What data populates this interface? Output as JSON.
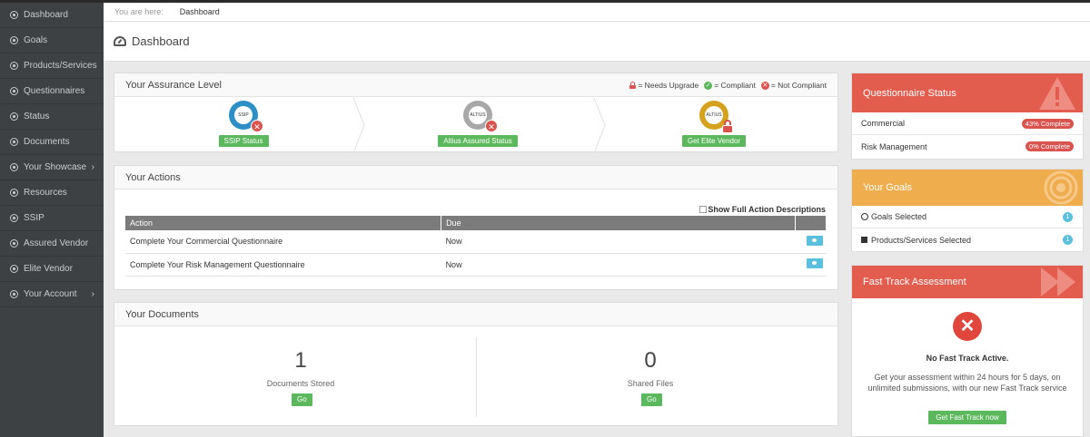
{
  "sidebar": {
    "items": [
      {
        "label": "Dashboard",
        "icon": "circle-dot-icon"
      },
      {
        "label": "Goals",
        "icon": "circle-dot-icon"
      },
      {
        "label": "Products/Services",
        "icon": "circle-dot-icon"
      },
      {
        "label": "Questionnaires",
        "icon": "circle-dot-icon"
      },
      {
        "label": "Status",
        "icon": "circle-dot-icon"
      },
      {
        "label": "Documents",
        "icon": "circle-dot-icon"
      },
      {
        "label": "Your Showcase",
        "icon": "circle-dot-icon",
        "chevron": "›"
      },
      {
        "label": "Resources",
        "icon": "circle-dot-icon"
      },
      {
        "label": "SSIP",
        "icon": "circle-dot-icon"
      },
      {
        "label": "Assured Vendor",
        "icon": "circle-dot-icon"
      },
      {
        "label": "Elite Vendor",
        "icon": "circle-dot-icon"
      },
      {
        "label": "Your Account",
        "icon": "circle-dot-icon",
        "chevron": "›"
      }
    ]
  },
  "breadcrumb": {
    "prefix": "You are here:",
    "current": "Dashboard"
  },
  "page": {
    "title": "Dashboard",
    "icon": "dashboard-gauge-icon"
  },
  "assurance": {
    "title": "Your Assurance Level",
    "legend": {
      "needs_upgrade": "= Needs Upgrade",
      "compliant": "= Compliant",
      "not_compliant": "= Not Compliant"
    },
    "badges": [
      {
        "seal_text": "SSIP",
        "button": "SSIP Status",
        "status": "not-compliant",
        "color": "#2e8fc7"
      },
      {
        "seal_text": "ALTIUS",
        "button": "Altius Assured Status",
        "status": "not-compliant",
        "color": "#9a9a9a"
      },
      {
        "seal_text": "ALTIUS",
        "button": "Get Elite Vendor",
        "status": "needs-upgrade",
        "color": "#d4a21c"
      }
    ]
  },
  "actions": {
    "title": "Your Actions",
    "show_desc_label": "Show Full Action Descriptions",
    "columns": [
      "Action",
      "Due",
      ""
    ],
    "rows": [
      {
        "action": "Complete Your Commercial Questionnaire",
        "due": "Now"
      },
      {
        "action": "Complete Your Risk Management Questionnaire",
        "due": "Now"
      }
    ]
  },
  "documents": {
    "title": "Your Documents",
    "stored": {
      "count": "1",
      "label": "Documents Stored",
      "button": "Go"
    },
    "shared": {
      "count": "0",
      "label": "Shared Files",
      "button": "Go"
    }
  },
  "questionnaire_status": {
    "title": "Questionnaire Status",
    "color": "#e35d4f",
    "rows": [
      {
        "label": "Commercial",
        "badge": "43% Complete"
      },
      {
        "label": "Risk Management",
        "badge": "0% Complete"
      }
    ]
  },
  "goals": {
    "title": "Your Goals",
    "color": "#f0ad4e",
    "rows": [
      {
        "label": "Goals Selected",
        "count": "1",
        "icon": "circle-dot-icon"
      },
      {
        "label": "Products/Services Selected",
        "count": "1",
        "icon": "archive-box-icon"
      }
    ]
  },
  "fast_track": {
    "title": "Fast Track Assessment",
    "color": "#e35d4f",
    "status": "No Fast Track Active.",
    "description": "Get your assessment within 24 hours for 5 days, on unlimited submissions, with our new Fast Track service",
    "button": "Get Fast Track now"
  }
}
